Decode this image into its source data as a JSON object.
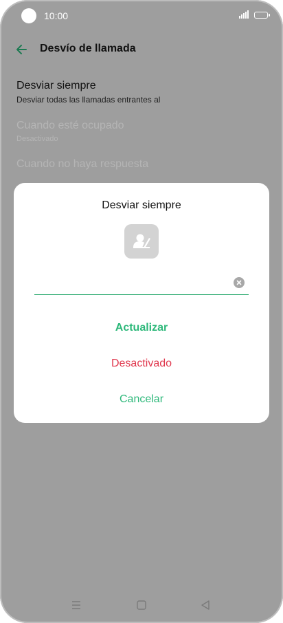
{
  "status_bar": {
    "time": "10:00"
  },
  "header": {
    "title": "Desvío de llamada",
    "back_icon": "arrow-left-icon"
  },
  "list": {
    "items": [
      {
        "title": "Desviar siempre",
        "subtitle": "Desviar todas las llamadas entrantes al",
        "enabled": true
      },
      {
        "title": "Cuando esté ocupado",
        "subtitle": "Desactivado",
        "enabled": false
      },
      {
        "title": "Cuando no haya respuesta",
        "subtitle": "",
        "enabled": false
      }
    ]
  },
  "dialog": {
    "title": "Desviar siempre",
    "contact_icon": "contact-picker-icon",
    "input_value": "",
    "update_label": "Actualizar",
    "deactivate_label": "Desactivado",
    "cancel_label": "Cancelar"
  },
  "nav": {
    "menu_icon": "menu-icon",
    "home_icon": "home-icon",
    "back_icon": "back-triangle-icon"
  },
  "colors": {
    "accent": "#2db87a",
    "danger": "#e0384e",
    "overlay": "#9e9e9e"
  }
}
